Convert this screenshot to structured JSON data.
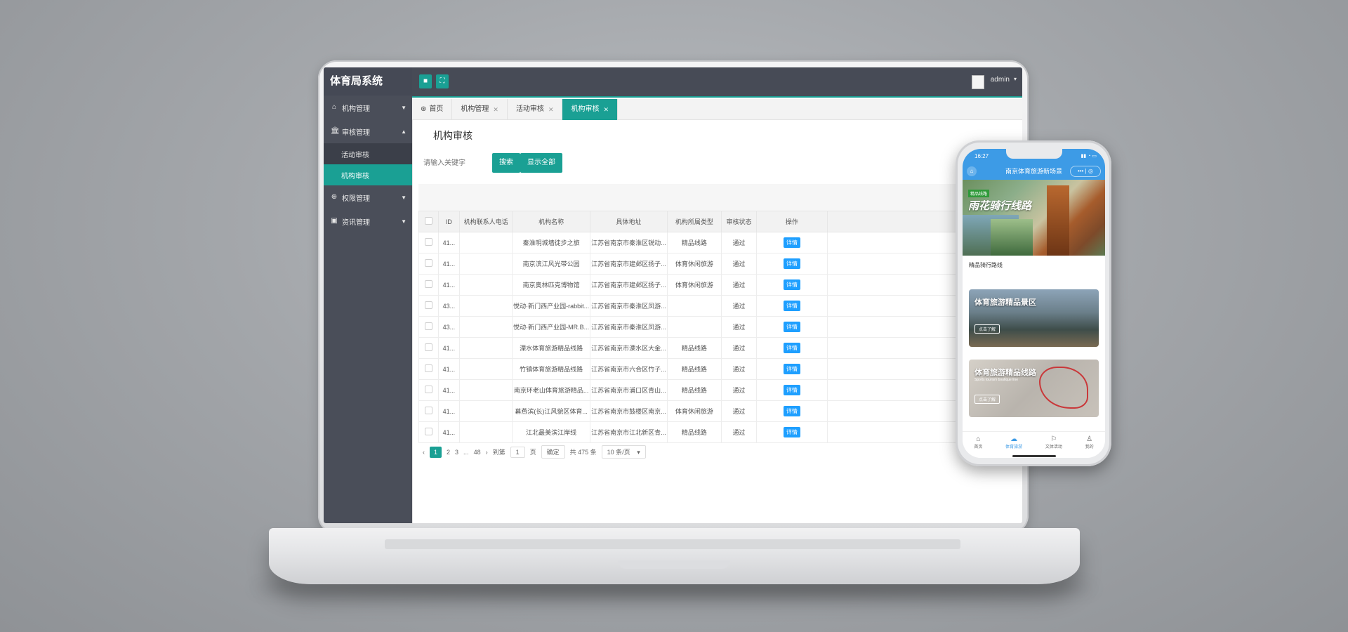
{
  "app": {
    "title": "体育局系统"
  },
  "sidebar": {
    "items": [
      {
        "label": "机构管理",
        "icon": "home-icon",
        "expanded": false
      },
      {
        "label": "审核管理",
        "icon": "bank-icon",
        "expanded": true,
        "children": [
          {
            "label": "活动审核",
            "active": false
          },
          {
            "label": "机构审核",
            "active": true
          }
        ]
      },
      {
        "label": "权限管理",
        "icon": "globe-icon",
        "expanded": false
      },
      {
        "label": "资讯管理",
        "icon": "image-icon",
        "expanded": false
      }
    ]
  },
  "topbar": {
    "user": "admin"
  },
  "tabs": [
    {
      "label": "首页",
      "closable": false
    },
    {
      "label": "机构管理",
      "closable": true
    },
    {
      "label": "活动审核",
      "closable": true
    },
    {
      "label": "机构审核",
      "closable": true,
      "active": true
    }
  ],
  "main": {
    "title": "机构审核",
    "search": {
      "placeholder": "请输入关键字",
      "value": ""
    },
    "buttons": {
      "search": "搜索",
      "show_all": "显示全部"
    },
    "table": {
      "columns": [
        "ID",
        "机构联系人电话",
        "机构名称",
        "具体地址",
        "机构所属类型",
        "审核状态",
        "操作"
      ],
      "rows": [
        {
          "id": "41...",
          "phone": "",
          "name": "秦淮明城墙徒步之旅",
          "address": "江苏省南京市秦淮区锐动...",
          "type": "精品线路",
          "status": "通过",
          "action": "详情"
        },
        {
          "id": "41...",
          "phone": "",
          "name": "南京滨江风光带公园",
          "address": "江苏省南京市建邺区扬子...",
          "type": "体育休闲旅游",
          "status": "通过",
          "action": "详情"
        },
        {
          "id": "41...",
          "phone": "",
          "name": "南京奥林匹克博物馆",
          "address": "江苏省南京市建邺区扬子...",
          "type": "体育休闲旅游",
          "status": "通过",
          "action": "详情"
        },
        {
          "id": "43...",
          "phone": "",
          "name": "悦动·新门西产业园-rabbit...",
          "address": "江苏省南京市秦淮区凤游...",
          "type": "",
          "status": "通过",
          "action": "详情"
        },
        {
          "id": "43...",
          "phone": "",
          "name": "悦动·新门西产业园-MR.B...",
          "address": "江苏省南京市秦淮区凤游...",
          "type": "",
          "status": "通过",
          "action": "详情"
        },
        {
          "id": "41...",
          "phone": "",
          "name": "溧水体育旅游精品线路",
          "address": "江苏省南京市溧水区大金...",
          "type": "精品线路",
          "status": "通过",
          "action": "详情"
        },
        {
          "id": "41...",
          "phone": "",
          "name": "竹镇体育旅游精品线路",
          "address": "江苏省南京市六合区竹子...",
          "type": "精品线路",
          "status": "通过",
          "action": "详情"
        },
        {
          "id": "41...",
          "phone": "",
          "name": "南京环老山体育旅游精品...",
          "address": "江苏省南京市浦口区青山...",
          "type": "精品线路",
          "status": "通过",
          "action": "详情"
        },
        {
          "id": "41...",
          "phone": "",
          "name": "幕燕滨(长)江风貌区体育...",
          "address": "江苏省南京市鼓楼区南京...",
          "type": "体育休闲旅游",
          "status": "通过",
          "action": "详情"
        },
        {
          "id": "41...",
          "phone": "",
          "name": "江北最美滨江岸线",
          "address": "江苏省南京市江北新区青...",
          "type": "精品线路",
          "status": "通过",
          "action": "详情"
        }
      ]
    },
    "pagination": {
      "current": "1",
      "page2": "2",
      "page3": "3",
      "ellipsis": "...",
      "last": "48",
      "goto_label": "到第",
      "goto_value": "1",
      "page_unit": "页",
      "confirm": "确定",
      "total": "共 475 条",
      "page_size": "10 条/页"
    }
  },
  "phone": {
    "time": "16:27",
    "nav_title": "南京体育旅游新场景",
    "banner": {
      "tag": "精品线路",
      "title": "雨花骑行线路"
    },
    "section_label": "精品骑行路线",
    "cards": [
      {
        "title": "体育旅游精品景区",
        "subtitle": "",
        "button": "点击了解"
      },
      {
        "title": "体育旅游精品线路",
        "subtitle": "Sports tourism boutique line",
        "button": "点击了解"
      }
    ],
    "tabbar": [
      {
        "label": "首页",
        "icon": "home-icon",
        "active": false
      },
      {
        "label": "体育旅游",
        "icon": "swim-icon",
        "active": true
      },
      {
        "label": "文体活动",
        "icon": "run-icon",
        "active": false
      },
      {
        "label": "我的",
        "icon": "user-icon",
        "active": false
      }
    ]
  },
  "colors": {
    "accent": "#1aa094",
    "sidebar": "#4a4e59",
    "detail_button": "#1e9fff",
    "phone_nav": "#3d9be6"
  }
}
